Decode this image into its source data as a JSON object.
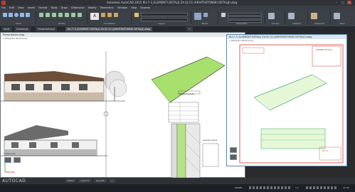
{
  "titlebar": {
    "title": "Autodesk AutoCAD 2015   KU-7-3_ELEMENTI DETALJI ZA EJ CG (ARHITEKTONSKI DETALJI).dwg",
    "minimize": "–",
    "maximize": "□",
    "close": "×"
  },
  "menubar": {
    "items": [
      "File",
      "Edit",
      "View",
      "Insert",
      "Format",
      "Tools",
      "Draw",
      "Dimension",
      "Modify",
      "Parametric",
      "Window",
      "Help",
      "Express"
    ]
  },
  "ribbon": {
    "groups": [
      "Draw",
      "Modify",
      "Annotation",
      "Layers",
      "Block",
      "Properties",
      "Groups",
      "Utilities",
      "Clipboard",
      "View"
    ]
  },
  "tabs": {
    "items": [
      "Start",
      "Drawing1",
      "Presentation2",
      "KU-7-3_ELEMENTI DETALJI ZA EJ CG (ARHITEKTONSKI DETALJI).dwg"
    ],
    "add": "+"
  },
  "win1": {
    "caption": "Presentation.dwg",
    "viewport_label": "[–][Top][2D Wireframe]",
    "detail_label": "Detalj krovišta",
    "table_label": "Legenda slojeva",
    "wall_label": "Detalj zida"
  },
  "win2": {
    "caption": "KU-7-3_ELEMENTI DETALJI ZA EJ CG (ARHITEKTONSKI DETALJI).dwg",
    "viewport_label": "[–][Top][2D Wireframe]",
    "sheet_title": "ELEMENTI DETALJI",
    "stamp_text": "KU-7-3"
  },
  "commandline": {
    "logo": "AUTOCAD",
    "layout_tabs": [
      "Model",
      "Layout1",
      "Layout2",
      "+"
    ]
  },
  "statusbar": {
    "model": "MODEL",
    "scale": "1:1",
    "time": "12:45"
  }
}
